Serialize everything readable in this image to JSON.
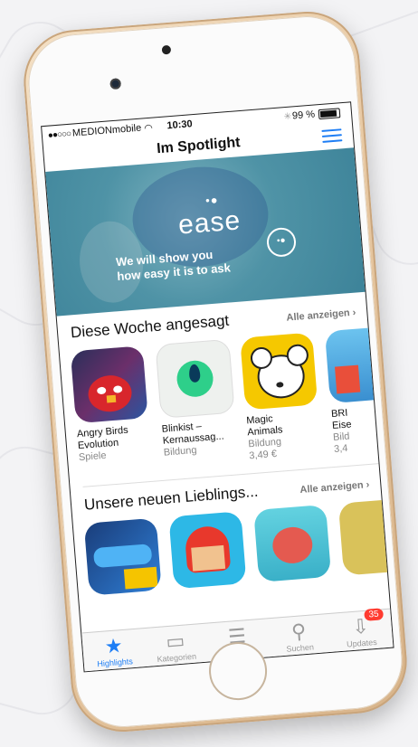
{
  "status": {
    "signal": "●●○○○",
    "carrier": "MEDIONmobile",
    "time": "10:30",
    "battery": "99 %"
  },
  "nav": {
    "title": "Im Spotlight"
  },
  "banner": {
    "logo": "ease",
    "logo_dots": "•●",
    "line1": "We will show you",
    "line2": "how easy it is to ask",
    "bubble": "•●"
  },
  "section1": {
    "title": "Diese Woche angesagt",
    "see_all": "Alle anzeigen",
    "apps": [
      {
        "name1": "Angry Birds",
        "name2": "Evolution",
        "category": "Spiele",
        "price": ""
      },
      {
        "name1": "Blinkist –",
        "name2": "Kernaussag...",
        "category": "Bildung",
        "price": ""
      },
      {
        "name1": "Magic",
        "name2": "Animals",
        "category": "Bildung",
        "price": "3,49 €"
      },
      {
        "name1": "BRI",
        "name2": "Eise",
        "category": "Bild",
        "price": "3,4"
      }
    ]
  },
  "section2": {
    "title": "Unsere neuen Lieblings...",
    "see_all": "Alle anzeigen"
  },
  "tabs": [
    {
      "label": "Highlights"
    },
    {
      "label": "Kategorien"
    },
    {
      "label": "Topcharts"
    },
    {
      "label": "Suchen"
    },
    {
      "label": "Updates",
      "badge": "35"
    }
  ],
  "colors": {
    "accent": "#1e7ef5",
    "badge": "#ff3b30"
  }
}
